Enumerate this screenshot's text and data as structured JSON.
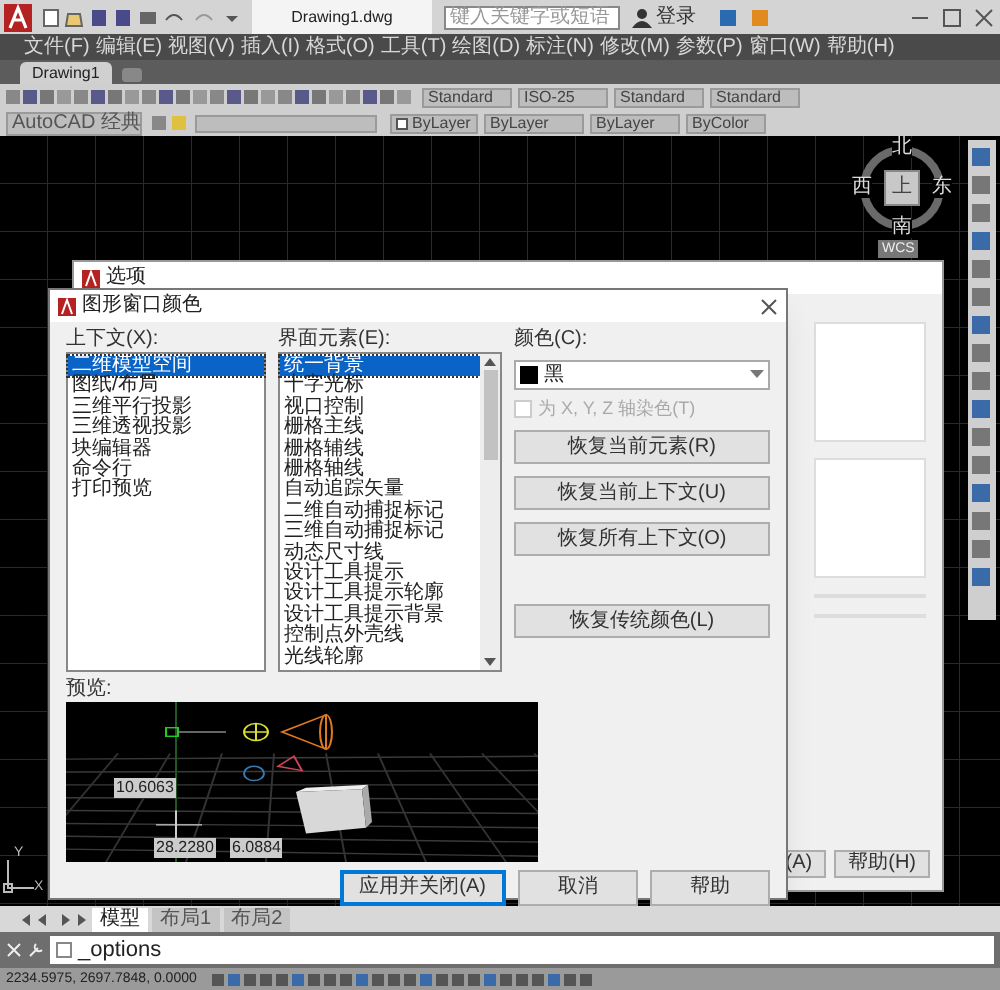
{
  "app": {
    "title": "Drawing1.dwg",
    "search": {
      "placeholder": "键入关键字或短语"
    },
    "sign_in": "登录"
  },
  "menu": [
    "文件(F)",
    "编辑(E)",
    "视图(V)",
    "插入(I)",
    "格式(O)",
    "工具(T)",
    "绘图(D)",
    "标注(N)",
    "修改(M)",
    "参数(P)",
    "窗口(W)",
    "帮助(H)"
  ],
  "doc_tabs": [
    {
      "label": "Drawing1",
      "selected": true
    }
  ],
  "toolbar": {
    "text_style": "Standard",
    "dim_style": "ISO-25",
    "table_style": "Standard",
    "mleader_style": "Standard",
    "workspace": "AutoCAD 经典",
    "color_control": "ByLayer",
    "linetype": "ByLayer",
    "lineweight": "ByLayer",
    "plot_style": "ByColor"
  },
  "viewcube": {
    "top": "上",
    "north": "北",
    "east": "东",
    "south": "南",
    "west": "西",
    "ucs": "WCS"
  },
  "ucs_icon": {
    "y": "Y",
    "x": "X"
  },
  "layout_tabs": [
    {
      "label": "模型",
      "selected": true
    },
    {
      "label": "布局1",
      "selected": false
    },
    {
      "label": "布局2",
      "selected": false
    }
  ],
  "command_line": {
    "value": "_options"
  },
  "status_bar": {
    "coordinates": "2234.5975, 2697.7848, 0.0000"
  },
  "options_dialog": {
    "title": "选项",
    "buttons": [
      "(A)",
      "帮助(H)"
    ]
  },
  "color_dialog": {
    "title": "图形窗口颜色",
    "context_label": "上下文(X):",
    "contexts": [
      {
        "label": "二维模型空间",
        "selected": true
      },
      {
        "label": "图纸/布局",
        "selected": false
      },
      {
        "label": "三维平行投影",
        "selected": false
      },
      {
        "label": "三维透视投影",
        "selected": false
      },
      {
        "label": "块编辑器",
        "selected": false
      },
      {
        "label": "命令行",
        "selected": false
      },
      {
        "label": "打印预览",
        "selected": false
      }
    ],
    "elements_label": "界面元素(E):",
    "elements": [
      {
        "label": "统一背景",
        "selected": true
      },
      {
        "label": "十字光标",
        "selected": false
      },
      {
        "label": "视口控制",
        "selected": false
      },
      {
        "label": "栅格主线",
        "selected": false
      },
      {
        "label": "栅格辅线",
        "selected": false
      },
      {
        "label": "栅格轴线",
        "selected": false
      },
      {
        "label": "自动追踪矢量",
        "selected": false
      },
      {
        "label": "二维自动捕捉标记",
        "selected": false
      },
      {
        "label": "三维自动捕捉标记",
        "selected": false
      },
      {
        "label": "动态尺寸线",
        "selected": false
      },
      {
        "label": "设计工具提示",
        "selected": false
      },
      {
        "label": "设计工具提示轮廓",
        "selected": false
      },
      {
        "label": "设计工具提示背景",
        "selected": false
      },
      {
        "label": "控制点外壳线",
        "selected": false
      },
      {
        "label": "光线轮廓",
        "selected": false
      }
    ],
    "color_label": "颜色(C):",
    "color_value": "黑",
    "tint_checkbox": {
      "label": "为 X, Y, Z 轴染色(T)",
      "checked": false,
      "disabled": true
    },
    "restore_buttons": [
      "恢复当前元素(R)",
      "恢复当前上下文(U)",
      "恢复所有上下文(O)",
      "恢复传统颜色(L)"
    ],
    "preview_label": "预览:",
    "preview_values": [
      "10.6063",
      "28.2280",
      "6.0884"
    ],
    "buttons": [
      {
        "label": "应用并关闭(A)",
        "kind": "default"
      },
      {
        "label": "取消",
        "kind": "normal"
      },
      {
        "label": "帮助",
        "kind": "normal"
      }
    ]
  }
}
